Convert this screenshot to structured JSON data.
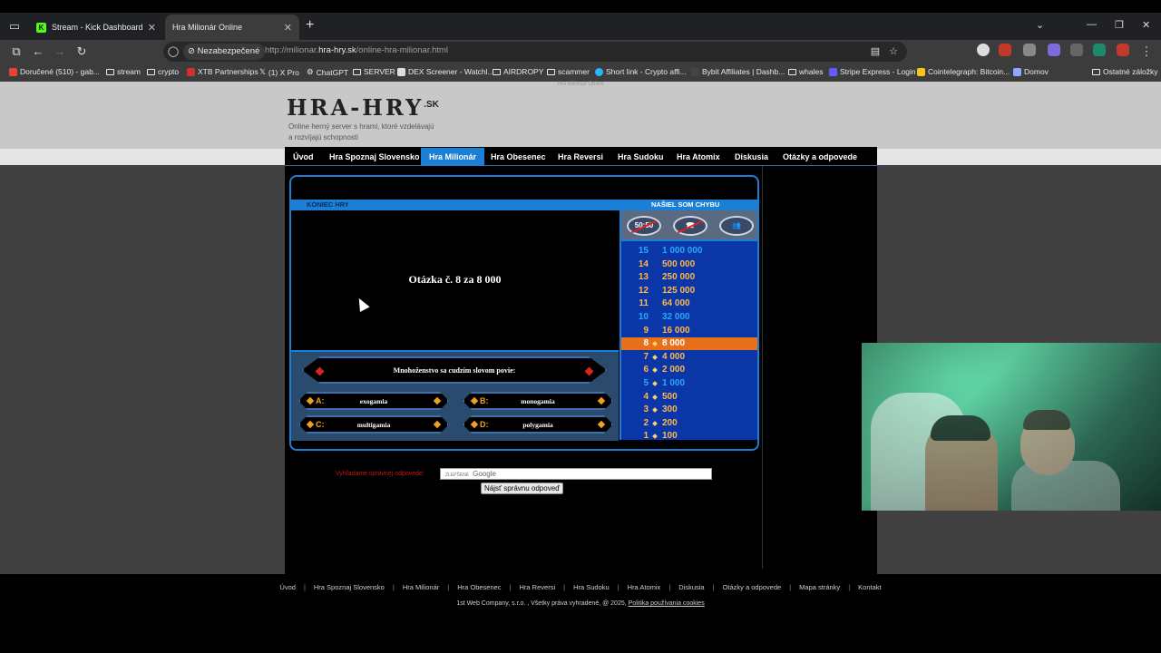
{
  "browser": {
    "tabs": [
      {
        "title": "Stream - Kick Dashboard",
        "active": false,
        "favicon_color": "#53fc18"
      },
      {
        "title": "Hra Milionár Online",
        "active": true
      }
    ],
    "security_label": "Nezabezpečené",
    "url_prefix": "http://milionar.",
    "url_domain": "hra-hry.sk",
    "url_path": "/online-hra-milionar.html",
    "bookmarks": [
      "Doručené (510) - gab...",
      "stream",
      "crypto",
      "XTB Partnerships",
      "(1) X Pro",
      "ChatGPT",
      "SERVER",
      "DEX Screener - Watchl...",
      "AIRDROPY",
      "scammer",
      "Short link - Crypto affi...",
      "Bybit Affiliates | Dashb...",
      "whales",
      "Stripe Express - Login",
      "Cointelegraph: Bitcoin...",
      "Domov"
    ],
    "other_bookmarks": "Ostatné záložky"
  },
  "site": {
    "header_small": "Hra Milionár Online",
    "logo": "HRA-HRY",
    "logo_tld": ".SK",
    "tagline_1": "Online herný server s hrami, ktoré vzdelávajú",
    "tagline_2": "a rozvíjajú schopnosti",
    "menu": [
      "Úvod",
      "Hra Spoznaj Slovensko",
      "Hra Milionár",
      "Hra Obesenec",
      "Hra Reversi",
      "Hra Sudoku",
      "Hra Atomix",
      "Diskusia",
      "Otázky a odpovede"
    ],
    "active_menu": "Hra Milionár"
  },
  "game": {
    "end_label": "KONIEC HRY",
    "report_label": "NAŠIEL SOM CHYBU",
    "question_title": "Otázka č. 8 za 8 000",
    "question": "Mnohoženstvo sa cudzím slovom povie:",
    "answers": [
      {
        "letter": "A:",
        "text": "exogamia"
      },
      {
        "letter": "B:",
        "text": "monogamia"
      },
      {
        "letter": "C:",
        "text": "multigamia"
      },
      {
        "letter": "D:",
        "text": "polygamia"
      }
    ],
    "lifelines": [
      {
        "name": "50:50",
        "used": true
      },
      {
        "name": "phone",
        "used": true
      },
      {
        "name": "audience",
        "used": false
      }
    ],
    "ladder": [
      {
        "level": "15",
        "amount": "1 000 000",
        "color": "#2aa8ff"
      },
      {
        "level": "14",
        "amount": "500 000",
        "color": "#ffb84a"
      },
      {
        "level": "13",
        "amount": "250 000",
        "color": "#ffb84a"
      },
      {
        "level": "12",
        "amount": "125 000",
        "color": "#ffb84a"
      },
      {
        "level": "11",
        "amount": "64 000",
        "color": "#ffb84a"
      },
      {
        "level": "10",
        "amount": "32 000",
        "color": "#2aa8ff"
      },
      {
        "level": "9",
        "amount": "16 000",
        "color": "#ffb84a"
      },
      {
        "level": "8",
        "amount": "8 000",
        "color": "#ffffff",
        "current": true
      },
      {
        "level": "7",
        "amount": "4 000",
        "color": "#ffb84a"
      },
      {
        "level": "6",
        "amount": "2 000",
        "color": "#ffb84a"
      },
      {
        "level": "5",
        "amount": "1 000",
        "color": "#2aa8ff"
      },
      {
        "level": "4",
        "amount": "500",
        "color": "#ffb84a"
      },
      {
        "level": "3",
        "amount": "300",
        "color": "#ffb84a"
      },
      {
        "level": "2",
        "amount": "200",
        "color": "#ffb84a"
      },
      {
        "level": "1",
        "amount": "100",
        "color": "#ffb84a"
      }
    ]
  },
  "search": {
    "label": "Vyhľadanie správnej odpovede:",
    "input_prefix": "ZLEPŠENÉ",
    "input_brand": "Google",
    "button": "Nájsť správnu odpoveď"
  },
  "footer": {
    "links": [
      "Úvod",
      "Hra Spoznaj Slovensko",
      "Hra Milionár",
      "Hra Obesenec",
      "Hra Reversi",
      "Hra Sudoku",
      "Hra Atomix",
      "Diskusia",
      "Otázky a odpovede",
      "Mapa stránky",
      "Kontakt"
    ],
    "copyright": "1st Web Company, s.r.o. , Všetky práva vyhradené, @ 2025,",
    "cookies": "Politika používania cookies"
  },
  "colors": {
    "accent_blue": "#1c7fd6",
    "current_level": "#e8701a",
    "ladder_bg": "#0a36a8"
  }
}
